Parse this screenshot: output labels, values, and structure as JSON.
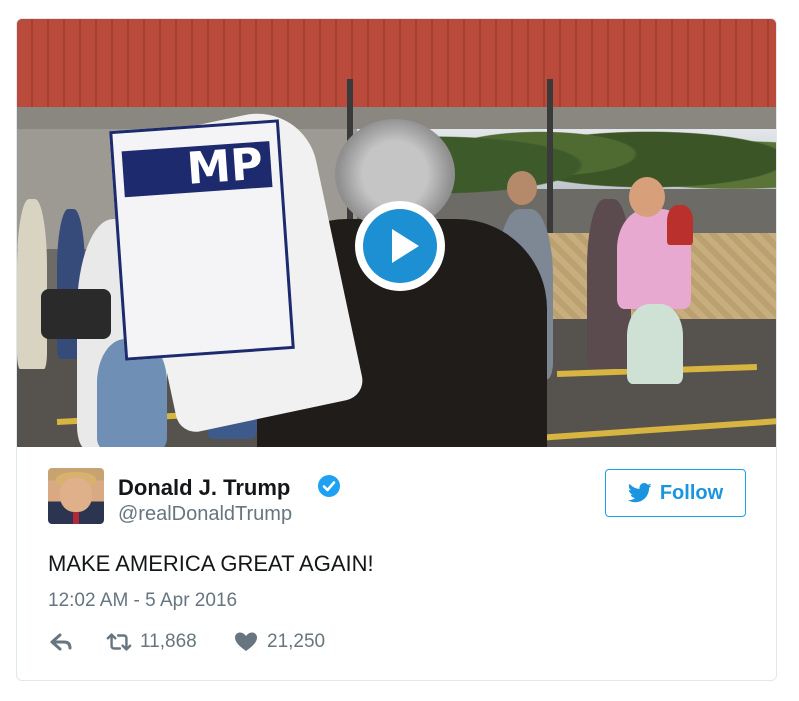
{
  "tweet": {
    "author_name": "Donald J. Trump",
    "author_handle": "@realDonaldTrump",
    "text": "MAKE AMERICA GREAT AGAIN!",
    "timestamp": "12:02 AM - 5 Apr 2016",
    "verified": true
  },
  "follow": {
    "label": "Follow"
  },
  "stats": {
    "retweets": "11,868",
    "likes": "21,250"
  },
  "media": {
    "type": "video",
    "play_icon": "play-icon",
    "sign_text": "MP"
  },
  "colors": {
    "accent": "#1da1f2",
    "muted": "#66757f",
    "text": "#14171a",
    "play": "#1d8fd3"
  }
}
